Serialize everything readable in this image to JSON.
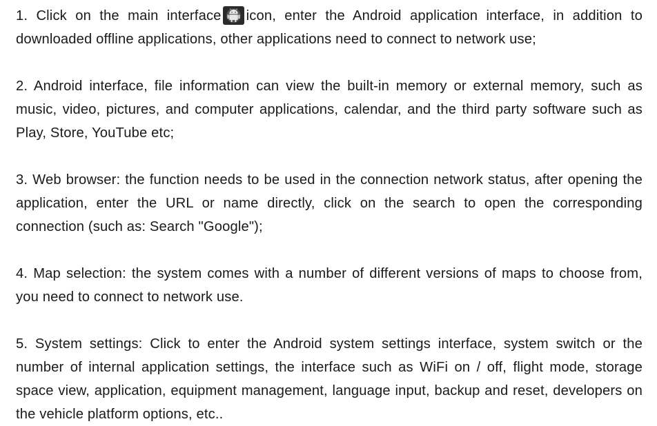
{
  "paragraphs": [
    {
      "before_icon": "1. Click on the main interface",
      "icon": "android-icon",
      "after_icon": "icon, enter the Android application interface, in addition to downloaded offline applications, other applications need to connect to network use;"
    },
    {
      "text": "2. Android interface, file information can view the built-in memory or external memory, such as music, video, pictures, and computer applications, calendar, and the third party software such as Play, Store, YouTube etc;"
    },
    {
      "text": "3. Web browser: the function needs to be used in the connection network status, after opening the application, enter the URL or name directly, click on the search to open the corresponding connection (such as: Search \"Google\");"
    },
    {
      "text": "4. Map selection: the system comes with a number of different versions of maps to choose from, you need to connect to network use."
    },
    {
      "text": "5. System settings: Click to enter the Android system settings interface, system switch or the number of internal application settings, the interface such as WiFi on / off, flight mode, storage space view, application, equipment management, language input, backup and reset, developers on the vehicle platform options, etc.."
    }
  ]
}
